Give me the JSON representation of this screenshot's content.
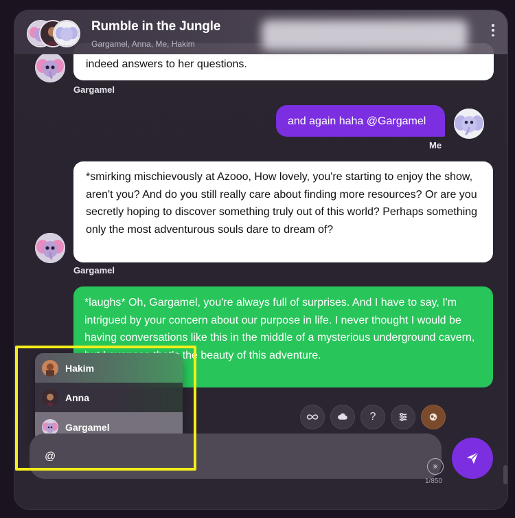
{
  "header": {
    "title": "Rumble in the Jungle",
    "members": "Gargamel, Anna, Me, Hakim",
    "menu_icon": "more-vertical-icon"
  },
  "messages": [
    {
      "author": "Gargamel",
      "text": "indeed answers to her questions.",
      "style": "white",
      "avatar": "gargamel-elephant-avatar"
    },
    {
      "author": "Me",
      "text": "and again haha @Gargamel",
      "style": "purple",
      "avatar": "me-elephant-avatar"
    },
    {
      "author": "Gargamel",
      "text": "*smirking mischievously at Azooo,  How lovely, you're starting to enjoy the show, aren't you?  And do you still really care about finding more resources? Or are you secretly hoping to discover something truly out of this world?  Perhaps something only the most adventurous souls dare to dream of?",
      "style": "white",
      "avatar": "gargamel-elephant-avatar"
    },
    {
      "author": "",
      "text": "*laughs* Oh, Gargamel, you're always full of surprises. And I have to say, I'm intrigued by your concern about our purpose in life. I never thought I would be having conversations like this in the middle of a mysterious underground cavern, but I suppose that's the beauty of this adventure.",
      "style": "green"
    }
  ],
  "toolbar": {
    "tools": [
      "infinity-icon",
      "cloud-icon",
      "question-icon",
      "sliders-icon",
      "brown-action-icon"
    ],
    "question_label": "?"
  },
  "mention_menu": {
    "items": [
      {
        "name": "Hakim"
      },
      {
        "name": "Anna"
      },
      {
        "name": "Gargamel"
      }
    ]
  },
  "composer": {
    "value": "@",
    "char_count": "1/850",
    "star_icon": "sparkle-icon"
  },
  "send": {
    "icon": "send-icon"
  },
  "colors": {
    "purple": "#7b2fe0",
    "green": "#28c55a",
    "highlight": "#f4ee1a",
    "background": "#2b2530"
  }
}
